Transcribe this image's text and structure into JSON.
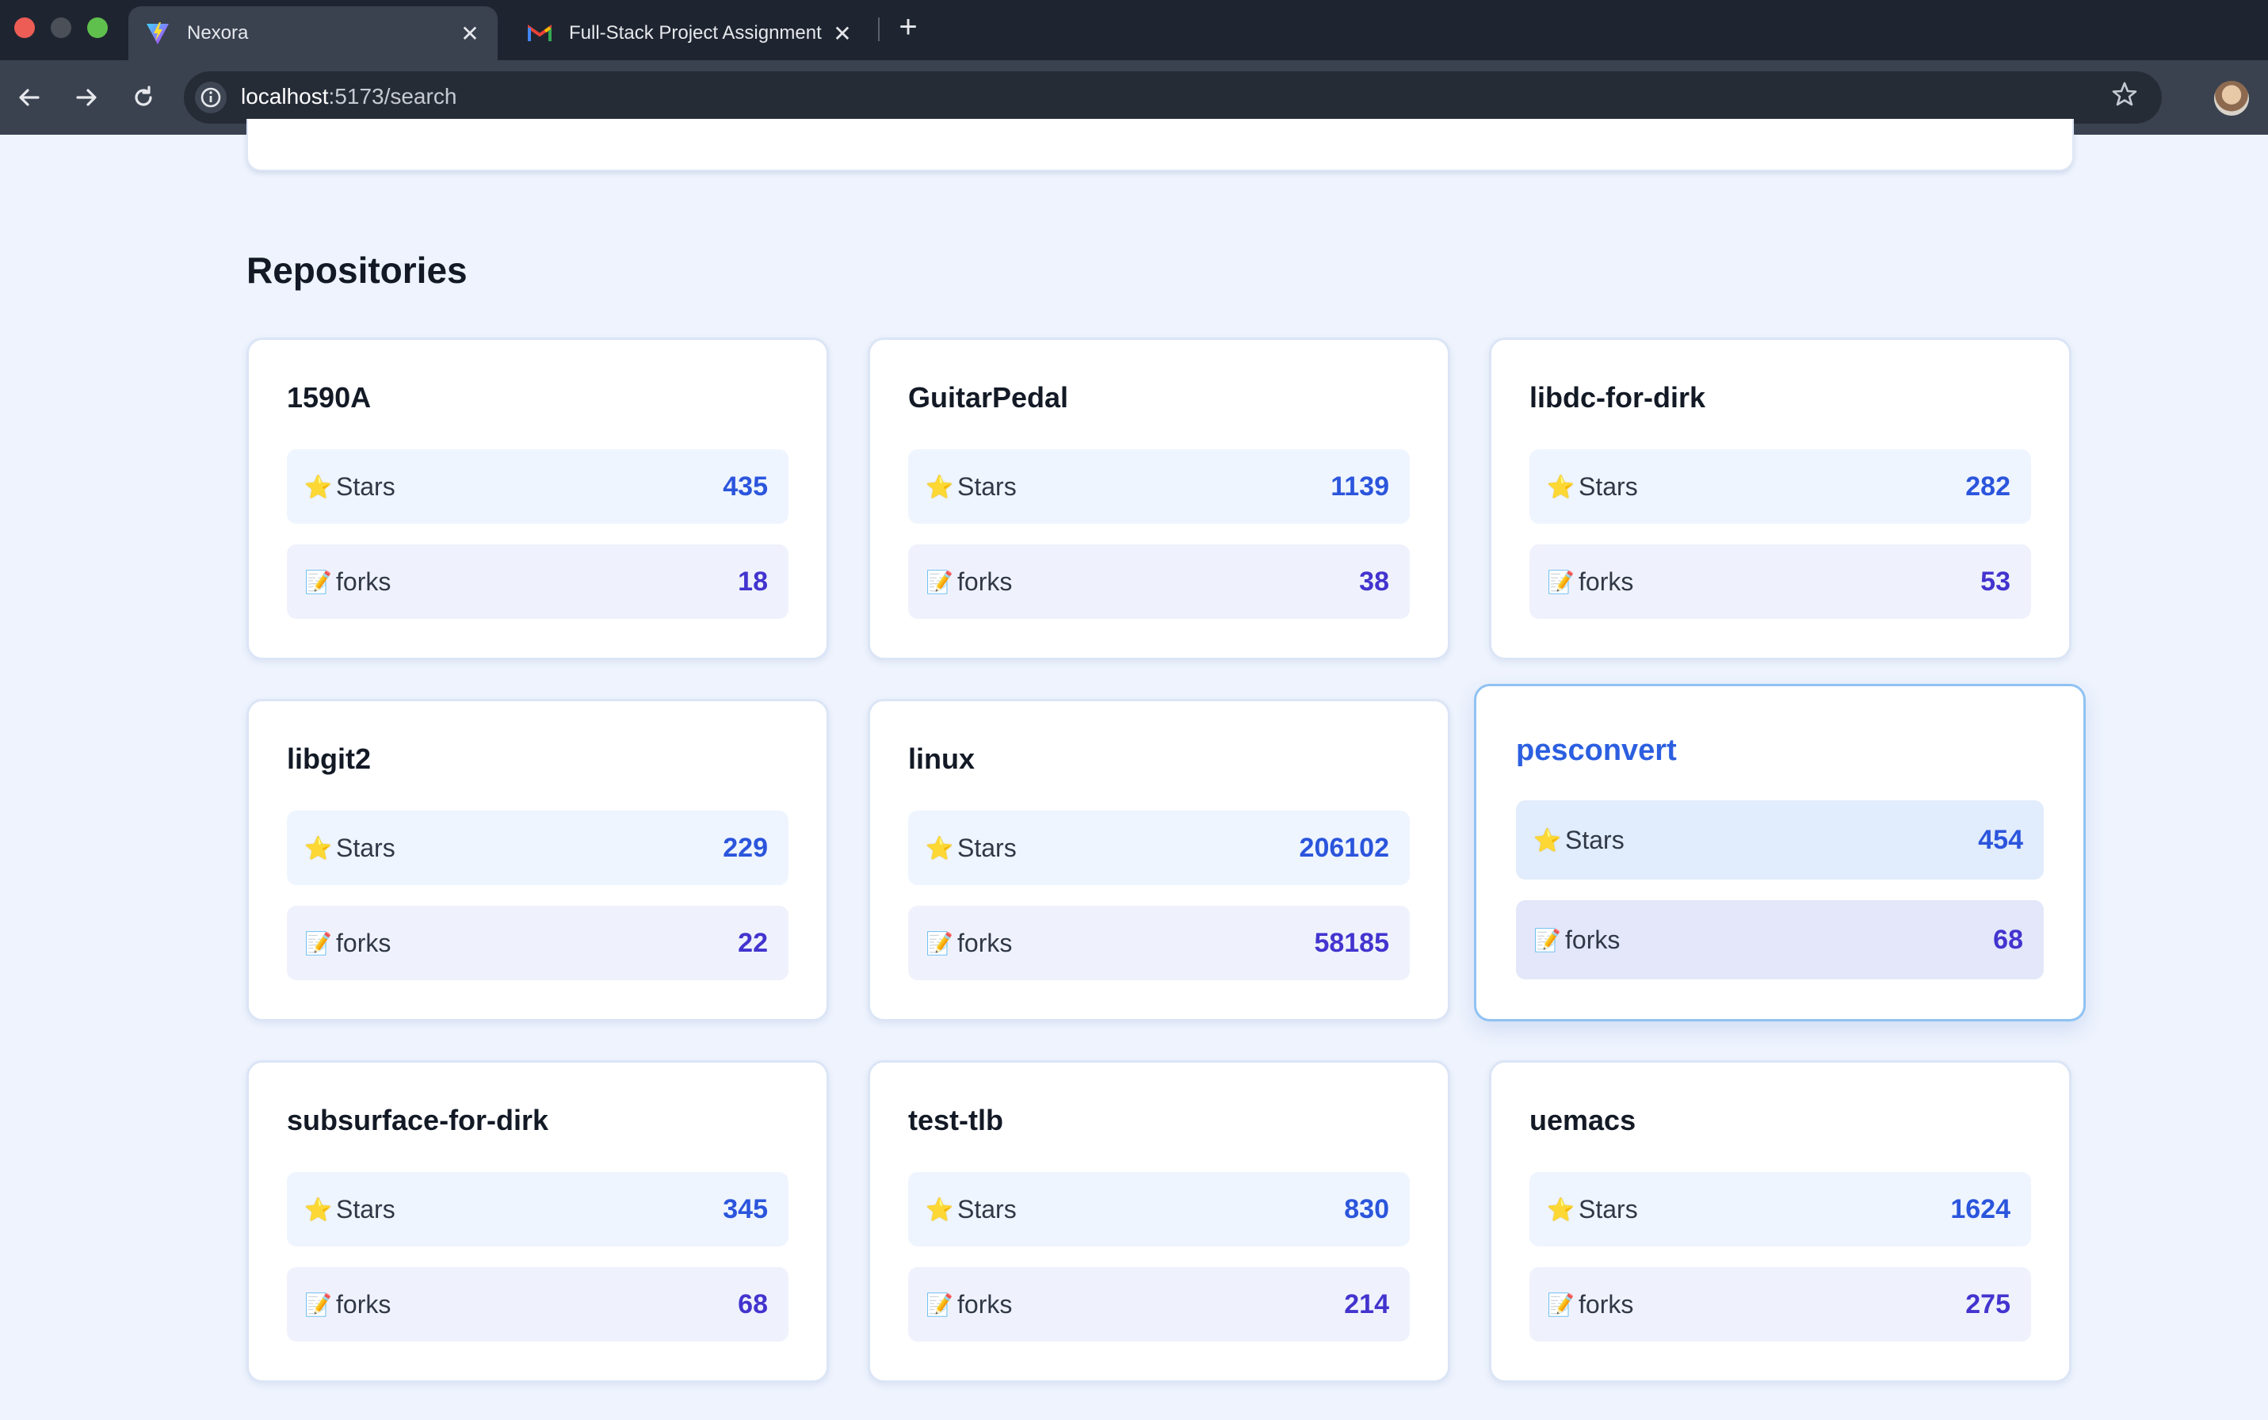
{
  "browser": {
    "tabs": [
      {
        "title": "Nexora",
        "active": true
      },
      {
        "title": "Full-Stack Project Assignment",
        "active": false
      }
    ],
    "new_tab_symbol": "+",
    "close_symbol": "✕",
    "url_host": "localhost",
    "url_rest": ":5173/search",
    "icons": [
      "back-arrow-icon",
      "forward-arrow-icon",
      "reload-icon",
      "site-info-icon",
      "bookmark-star-icon",
      "profile-avatar"
    ]
  },
  "page": {
    "section_title": "Repositories",
    "stat_labels": {
      "stars": "Stars",
      "forks": "forks"
    },
    "stat_icons": {
      "stars": "⭐",
      "forks": "📝"
    },
    "repos": [
      {
        "name": "1590A",
        "stars": "435",
        "forks": "18"
      },
      {
        "name": "GuitarPedal",
        "stars": "1139",
        "forks": "38"
      },
      {
        "name": "libdc-for-dirk",
        "stars": "282",
        "forks": "53"
      },
      {
        "name": "libgit2",
        "stars": "229",
        "forks": "22"
      },
      {
        "name": "linux",
        "stars": "206102",
        "forks": "58185"
      },
      {
        "name": "pesconvert",
        "stars": "454",
        "forks": "68"
      },
      {
        "name": "subsurface-for-dirk",
        "stars": "345",
        "forks": "68"
      },
      {
        "name": "test-tlb",
        "stars": "830",
        "forks": "214"
      },
      {
        "name": "uemacs",
        "stars": "1624",
        "forks": "275"
      }
    ],
    "hovered_repo": "pesconvert"
  },
  "colors": {
    "page_bg": "#eef3fd",
    "accent_blue": "#2b55dc",
    "fork_purple": "#4334cf",
    "hover_border": "#8fc2f2"
  }
}
